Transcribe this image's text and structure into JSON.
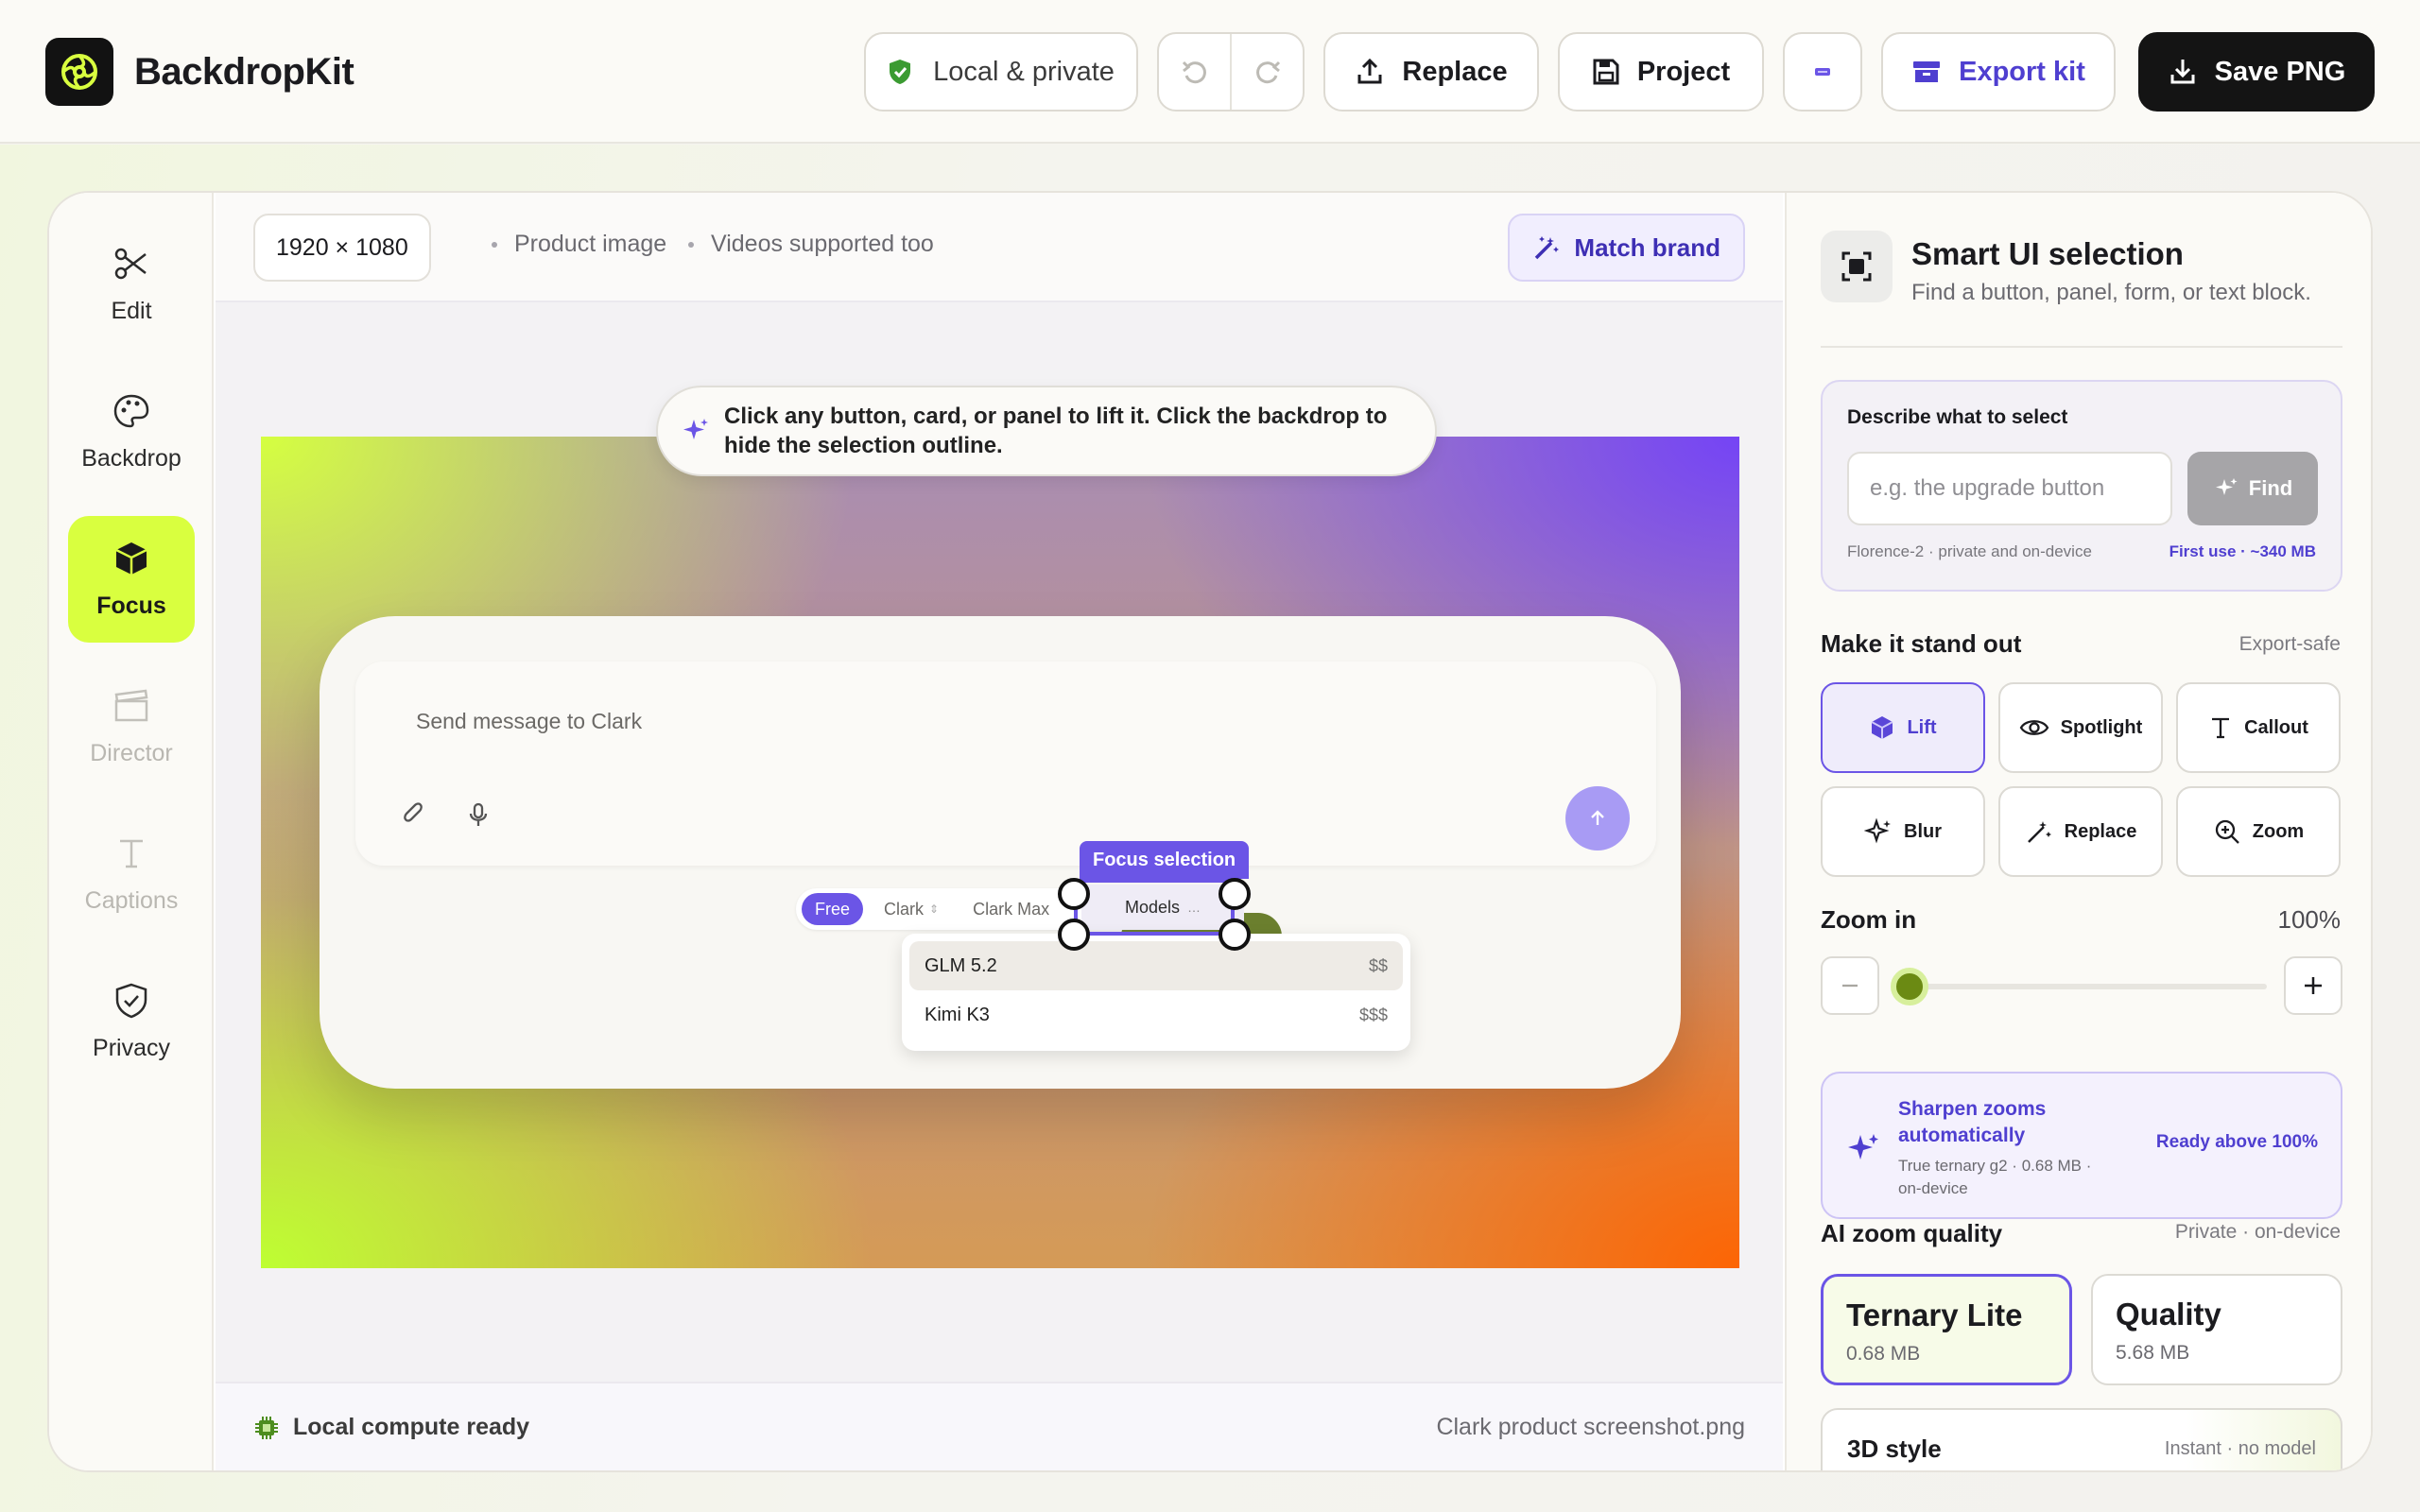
{
  "app": {
    "name": "BackdropKit"
  },
  "toolbar": {
    "private_label": "Local & private",
    "replace_label": "Replace",
    "project_label": "Project",
    "export_label": "Export kit",
    "save_label": "Save PNG"
  },
  "rail": {
    "items": [
      {
        "label": "Edit",
        "icon": "scissors-icon"
      },
      {
        "label": "Backdrop",
        "icon": "palette-icon"
      },
      {
        "label": "Focus",
        "icon": "cube-icon",
        "active": true
      },
      {
        "label": "Director",
        "icon": "clapperboard-icon",
        "disabled": true
      },
      {
        "label": "Captions",
        "icon": "text-icon",
        "disabled": true
      },
      {
        "label": "Privacy",
        "icon": "shield-check-icon"
      }
    ]
  },
  "canvas": {
    "dimensions": "1920 × 1080",
    "meta1": "Product image",
    "meta2": "Videos supported too",
    "match_brand": "Match brand",
    "hint": "Click any button, card, or panel to lift it. Click the backdrop to hide the selection outline.",
    "status": "Local compute ready",
    "filename": "Clark product screenshot.png"
  },
  "mock": {
    "placeholder": "Send message to Clark",
    "pills": [
      "Free",
      "Clark",
      "Clark Max"
    ],
    "models": "Models",
    "selection_label": "Focus selection",
    "dropdown": [
      {
        "name": "GLM 5.2",
        "price": "$$"
      },
      {
        "name": "Kimi K3",
        "price": "$$$"
      }
    ]
  },
  "panel": {
    "title": "Smart UI selection",
    "subtitle": "Find a button, panel, form, or text block.",
    "describe_label": "Describe what to select",
    "describe_placeholder": "e.g. the upgrade button",
    "find_label": "Find",
    "model_note": "Florence-2 · private and on-device",
    "first_use": "First use · ~340 MB",
    "standout_title": "Make it stand out",
    "standout_aux": "Export-safe",
    "effects": [
      {
        "label": "Lift",
        "icon": "cube-icon",
        "active": true
      },
      {
        "label": "Spotlight",
        "icon": "eye-icon"
      },
      {
        "label": "Callout",
        "icon": "text-icon"
      },
      {
        "label": "Blur",
        "icon": "sparkle-icon"
      },
      {
        "label": "Replace",
        "icon": "wand-icon"
      },
      {
        "label": "Zoom",
        "icon": "zoom-in-icon"
      }
    ],
    "zoom_title": "Zoom in",
    "zoom_value": "100%",
    "zoom_level": 0,
    "sharpen_title": "Sharpen zooms automatically",
    "sharpen_sub": "True ternary g2 · 0.68 MB · on-device",
    "sharpen_ready": "Ready above 100%",
    "ai_title": "AI zoom quality",
    "ai_aux": "Private · on-device",
    "qualities": [
      {
        "name": "Ternary Lite",
        "size": "0.68 MB",
        "active": true
      },
      {
        "name": "Quality",
        "size": "5.68 MB"
      }
    ],
    "style_title": "3D style",
    "style_aux": "Instant · no model"
  },
  "colors": {
    "accent": "#6b55e6",
    "focus": "#d9ff3f",
    "dark": "#141414"
  }
}
